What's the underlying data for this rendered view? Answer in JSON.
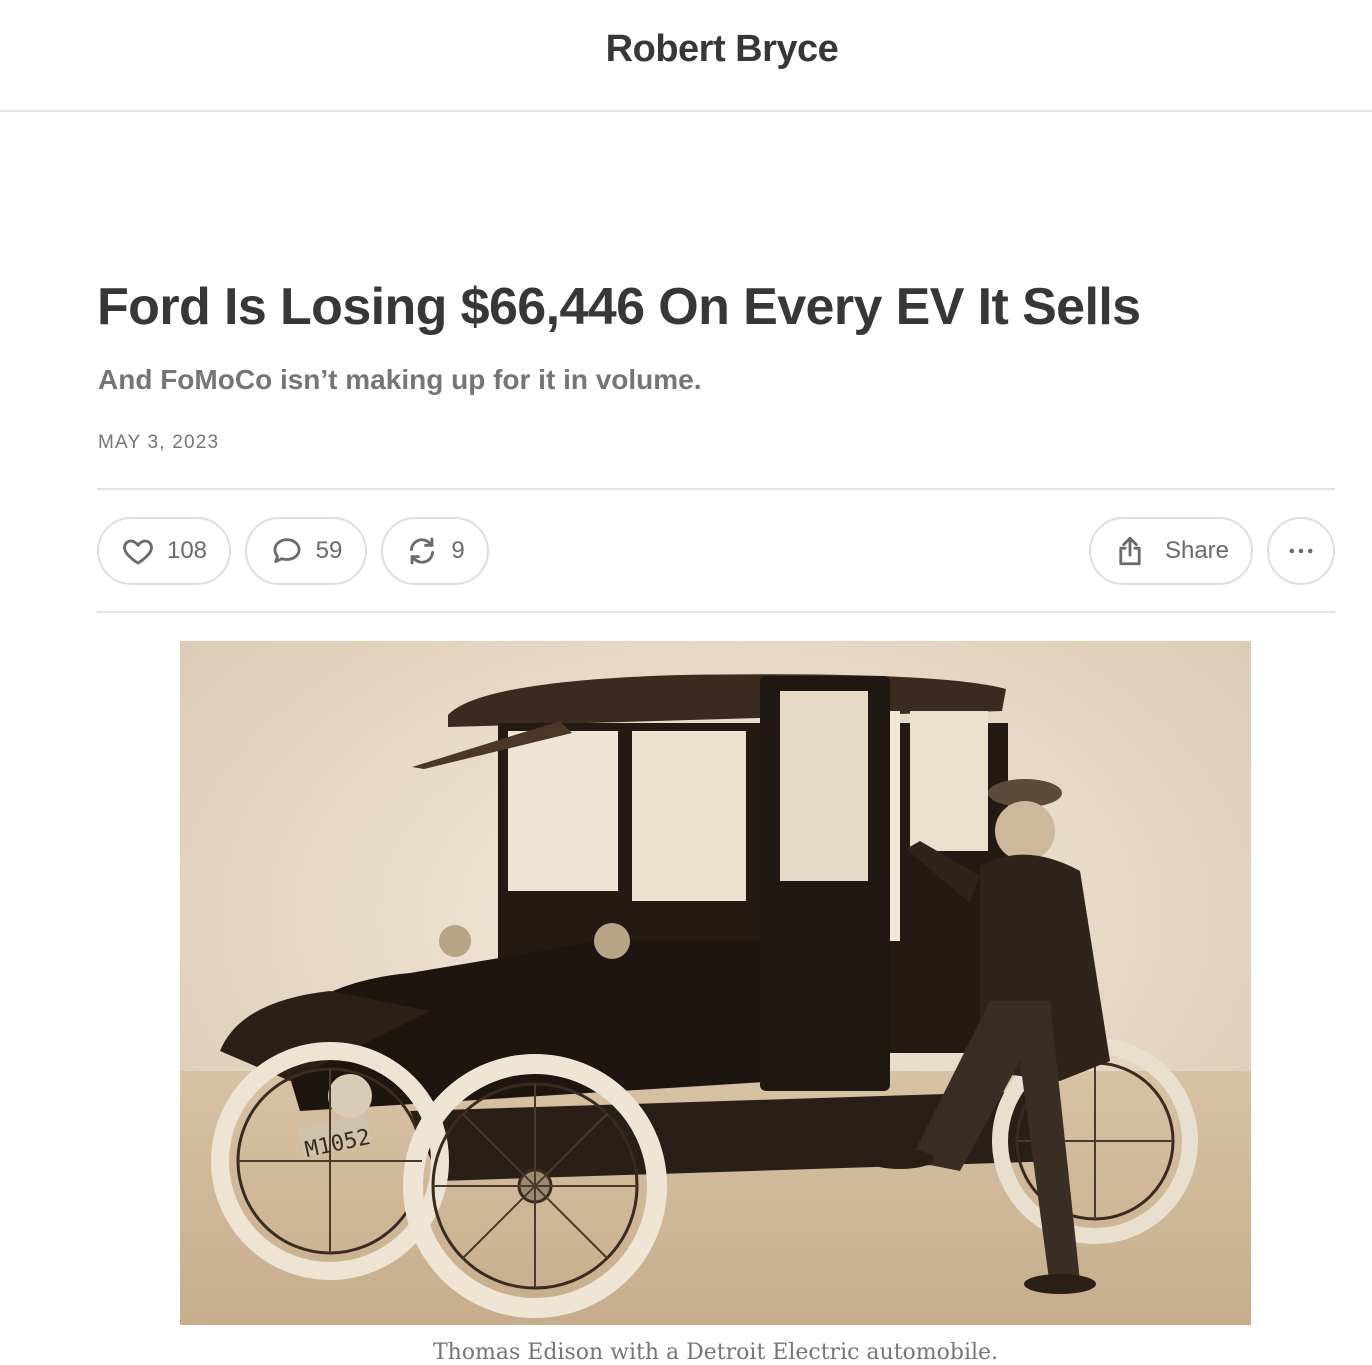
{
  "header": {
    "publication_name": "Robert Bryce"
  },
  "post": {
    "title": "Ford Is Losing $66,446 On Every EV It Sells",
    "subtitle": "And FoMoCo isn’t making up for it in volume.",
    "date": "MAY 3, 2023"
  },
  "actions": {
    "likes": "108",
    "comments": "59",
    "restacks": "9",
    "share_label": "Share",
    "icons": [
      "heart-icon",
      "comment-icon",
      "restack-icon",
      "share-icon",
      "more-icon"
    ]
  },
  "image": {
    "caption": "Thomas Edison with a Detroit Electric automobile.",
    "plate_text": "M1052"
  }
}
